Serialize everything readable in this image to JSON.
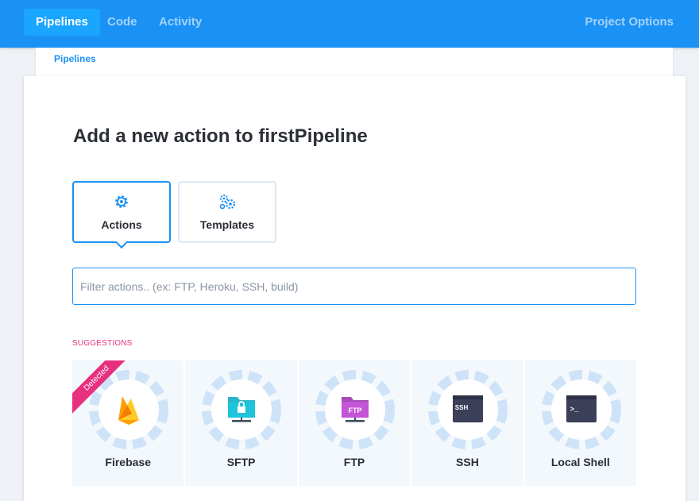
{
  "nav": {
    "tabs": [
      {
        "label": "Pipelines",
        "active": true
      },
      {
        "label": "Code",
        "active": false
      },
      {
        "label": "Activity",
        "active": false
      }
    ],
    "right_label": "Project Options"
  },
  "breadcrumb": "Pipelines",
  "title": "Add a new action to firstPipeline",
  "type_tabs": [
    {
      "label": "Actions",
      "icon": "gear-icon",
      "active": true
    },
    {
      "label": "Templates",
      "icon": "gears-icon",
      "active": false
    }
  ],
  "filter": {
    "placeholder": "Filter actions.. (ex: FTP, Heroku, SSH, build)",
    "value": ""
  },
  "suggestions": {
    "label": "SUGGESTIONS",
    "ribbon": "Detected",
    "items": [
      {
        "label": "Firebase",
        "icon": "firebase-icon"
      },
      {
        "label": "SFTP",
        "icon": "sftp-folder-icon"
      },
      {
        "label": "FTP",
        "icon": "ftp-folder-icon",
        "badge": "FTP"
      },
      {
        "label": "SSH",
        "icon": "ssh-terminal-icon",
        "badge": "SSH"
      },
      {
        "label": "Local Shell",
        "icon": "terminal-icon",
        "badge": ">_"
      }
    ]
  },
  "colors": {
    "primary": "#1a91f5",
    "accent": "#e8307f",
    "tile_bg": "#f3f8fd"
  }
}
